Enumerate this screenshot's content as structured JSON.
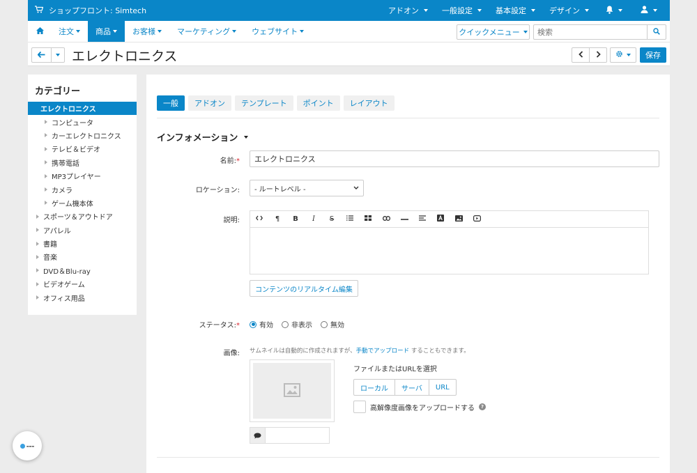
{
  "topbar": {
    "brand": "ショップフロント: Simtech",
    "menus": [
      "アドオン",
      "一般設定",
      "基本設定",
      "デザイン"
    ]
  },
  "navbar": {
    "items": [
      {
        "label": "注文",
        "active": false
      },
      {
        "label": "商品",
        "active": true
      },
      {
        "label": "お客様",
        "active": false
      },
      {
        "label": "マーケティング",
        "active": false
      },
      {
        "label": "ウェブサイト",
        "active": false
      }
    ],
    "quick_menu": "クイックメニュー",
    "search_placeholder": "検索"
  },
  "titlebar": {
    "title": "エレクトロニクス",
    "save_label": "保存"
  },
  "sidebar": {
    "heading": "カテゴリー",
    "items": [
      {
        "label": "エレクトロニクス",
        "level": "sel"
      },
      {
        "label": "コンピュータ",
        "level": "lvl1"
      },
      {
        "label": "カーエレクトロニクス",
        "level": "lvl1"
      },
      {
        "label": "テレビ＆ビデオ",
        "level": "lvl1"
      },
      {
        "label": "携帯電話",
        "level": "lvl1"
      },
      {
        "label": "MP3プレイヤー",
        "level": "lvl1"
      },
      {
        "label": "カメラ",
        "level": "lvl1"
      },
      {
        "label": "ゲーム機本体",
        "level": "lvl1"
      },
      {
        "label": "スポーツ＆アウトドア",
        "level": "lvl0"
      },
      {
        "label": "アパレル",
        "level": "lvl0"
      },
      {
        "label": "書籍",
        "level": "lvl0"
      },
      {
        "label": "音楽",
        "level": "lvl0"
      },
      {
        "label": "DVD＆Blu-ray",
        "level": "lvl0"
      },
      {
        "label": "ビデオゲーム",
        "level": "lvl0"
      },
      {
        "label": "オフィス用品",
        "level": "lvl0"
      }
    ]
  },
  "main": {
    "tabs": [
      {
        "label": "一般",
        "active": true
      },
      {
        "label": "アドオン",
        "active": false
      },
      {
        "label": "テンプレート",
        "active": false
      },
      {
        "label": "ポイント",
        "active": false
      },
      {
        "label": "レイアウト",
        "active": false
      }
    ],
    "section_title": "インフォメーション",
    "name_label": "名前:",
    "name_value": "エレクトロニクス",
    "location_label": "ロケーション:",
    "location_value": "- ルートレベル -",
    "description_label": "説明:",
    "live_edit_label": "コンテンツのリアルタイム編集",
    "status_label": "ステータス:",
    "status_options": [
      "有効",
      "非表示",
      "無効"
    ],
    "status_selected": "有効",
    "image_label": "画像:",
    "image_hint_pre": "サムネイルは自動的に作成されますが、",
    "image_hint_link": "手動でアップロード",
    "image_hint_post": " することもできます。",
    "choose_label": "ファイルまたはURLを選択",
    "source_buttons": [
      "ローカル",
      "サーバ",
      "URL"
    ],
    "hires_label": "高解像度画像をアップロードする"
  }
}
